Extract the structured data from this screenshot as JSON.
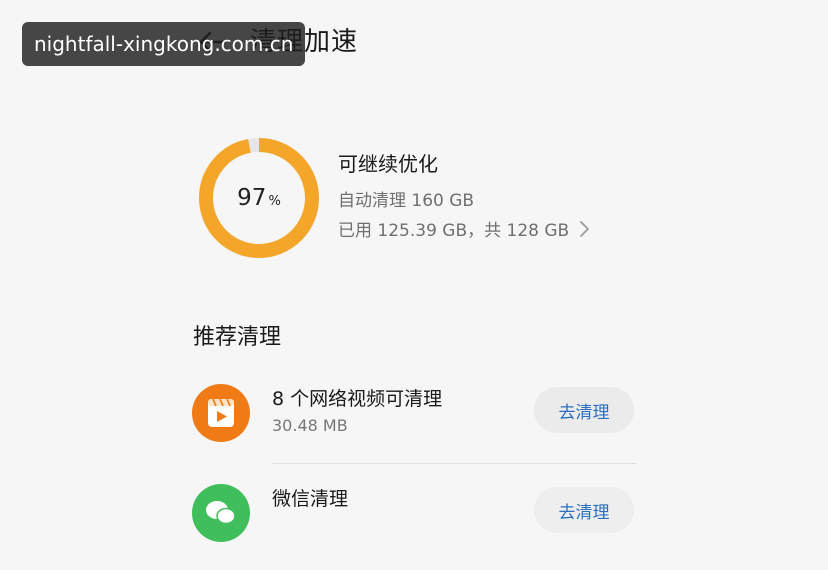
{
  "watermark": "nightfall-xingkong.com.cn",
  "header": {
    "title": "清理加速",
    "back_icon": "arrow-left-icon"
  },
  "storage": {
    "percent": 97,
    "percent_value": "97",
    "percent_unit": "%",
    "status": "可继续优化",
    "auto_clean": "自动清理 160 GB",
    "usage": "已用 125.39 GB，共 128 GB",
    "ring_color": "#f4a62a",
    "ring_track_color": "#e6e6e6"
  },
  "recommend": {
    "title": "推荐清理",
    "items": [
      {
        "title": "8 个网络视频可清理",
        "size": "30.48 MB",
        "action": "去清理",
        "icon": "video-clip-icon",
        "color": "#f07a16"
      },
      {
        "title": "微信清理",
        "size": "",
        "action": "去清理",
        "icon": "wechat-icon",
        "color": "#3fbe5b"
      }
    ]
  },
  "colors": {
    "action_text": "#2a6fbf"
  }
}
